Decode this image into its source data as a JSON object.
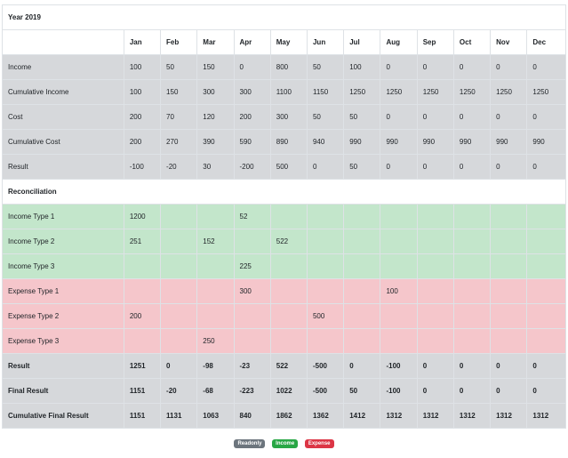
{
  "title": "Year 2019",
  "months": [
    "Jan",
    "Feb",
    "Mar",
    "Apr",
    "May",
    "Jun",
    "Jul",
    "Aug",
    "Sep",
    "Oct",
    "Nov",
    "Dec"
  ],
  "summary_rows": [
    {
      "label": "Income",
      "values": [
        "100",
        "50",
        "150",
        "0",
        "800",
        "50",
        "100",
        "0",
        "0",
        "0",
        "0",
        "0"
      ]
    },
    {
      "label": "Cumulative Income",
      "values": [
        "100",
        "150",
        "300",
        "300",
        "1100",
        "1150",
        "1250",
        "1250",
        "1250",
        "1250",
        "1250",
        "1250"
      ]
    },
    {
      "label": "Cost",
      "values": [
        "200",
        "70",
        "120",
        "200",
        "300",
        "50",
        "50",
        "0",
        "0",
        "0",
        "0",
        "0"
      ]
    },
    {
      "label": "Cumulative Cost",
      "values": [
        "200",
        "270",
        "390",
        "590",
        "890",
        "940",
        "990",
        "990",
        "990",
        "990",
        "990",
        "990"
      ]
    },
    {
      "label": "Result",
      "values": [
        "-100",
        "-20",
        "30",
        "-200",
        "500",
        "0",
        "50",
        "0",
        "0",
        "0",
        "0",
        "0"
      ]
    }
  ],
  "reconciliation_title": "Reconciliation",
  "income_rows": [
    {
      "label": "Income Type 1",
      "values": [
        "1200",
        "",
        "",
        "52",
        "",
        "",
        "",
        "",
        "",
        "",
        "",
        ""
      ]
    },
    {
      "label": "Income Type 2",
      "values": [
        "251",
        "",
        "152",
        "",
        "522",
        "",
        "",
        "",
        "",
        "",
        "",
        ""
      ]
    },
    {
      "label": "Income Type 3",
      "values": [
        "",
        "",
        "",
        "225",
        "",
        "",
        "",
        "",
        "",
        "",
        "",
        ""
      ]
    }
  ],
  "expense_rows": [
    {
      "label": "Expense Type 1",
      "values": [
        "",
        "",
        "",
        "300",
        "",
        "",
        "",
        "100",
        "",
        "",
        "",
        ""
      ]
    },
    {
      "label": "Expense Type 2",
      "values": [
        "200",
        "",
        "",
        "",
        "",
        "500",
        "",
        "",
        "",
        "",
        "",
        ""
      ]
    },
    {
      "label": "Expense Type 3",
      "values": [
        "",
        "",
        "250",
        "",
        "",
        "",
        "",
        "",
        "",
        "",
        "",
        ""
      ]
    }
  ],
  "total_rows": [
    {
      "label": "Result",
      "values": [
        "1251",
        "0",
        "-98",
        "-23",
        "522",
        "-500",
        "0",
        "-100",
        "0",
        "0",
        "0",
        "0"
      ]
    },
    {
      "label": "Final Result",
      "values": [
        "1151",
        "-20",
        "-68",
        "-223",
        "1022",
        "-500",
        "50",
        "-100",
        "0",
        "0",
        "0",
        "0"
      ]
    },
    {
      "label": "Cumulative Final Result",
      "values": [
        "1151",
        "1131",
        "1063",
        "840",
        "1862",
        "1362",
        "1412",
        "1312",
        "1312",
        "1312",
        "1312",
        "1312"
      ]
    }
  ],
  "legend": {
    "readonly": "Readonly",
    "income": "Income",
    "expense": "Expense"
  },
  "colors": {
    "readonly": "#6c757d",
    "income": "#28a745",
    "expense": "#dc3545"
  }
}
